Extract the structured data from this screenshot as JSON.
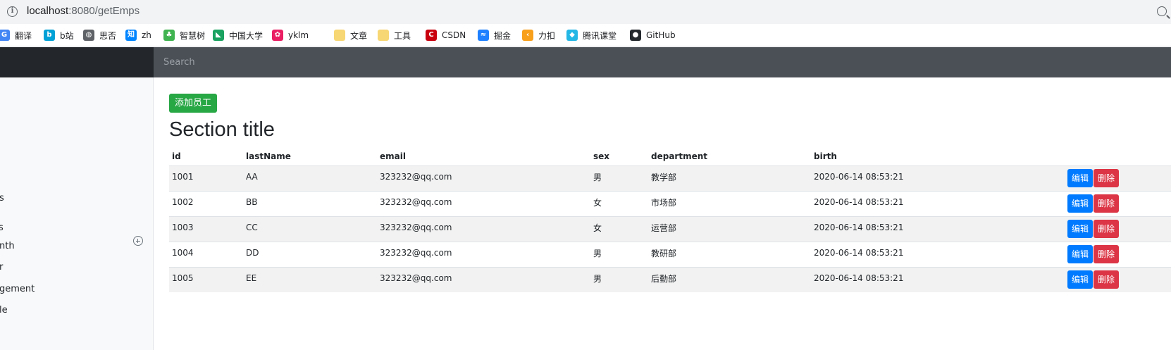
{
  "browser": {
    "url_host": "localhost",
    "url_rest": ":8080/getEmps"
  },
  "bookmarks": [
    {
      "label": "翻译",
      "icon": "google-translate-icon",
      "color": "#4285f4",
      "glyph": "G"
    },
    {
      "label": "b站",
      "icon": "bilibili-icon",
      "color": "#00a1d6",
      "glyph": "b"
    },
    {
      "label": "思否",
      "icon": "globe-icon",
      "color": "#5f6368",
      "glyph": "◍"
    },
    {
      "label": "zh",
      "icon": "zhihu-icon",
      "color": "#0084ff",
      "glyph": "知"
    },
    {
      "label": "智慧树",
      "icon": "zhihuishu-icon",
      "color": "#3fb34f",
      "glyph": "♣"
    },
    {
      "label": "中国大学",
      "icon": "mooc-icon",
      "color": "#1aa260",
      "glyph": "◣"
    },
    {
      "label": "yklm",
      "icon": "yklm-icon",
      "color": "#e91e63",
      "glyph": "✿"
    },
    {
      "label": "文章",
      "icon": "folder-icon",
      "color": "#f7d774",
      "glyph": ""
    },
    {
      "label": "工具",
      "icon": "folder-icon",
      "color": "#f7d774",
      "glyph": ""
    },
    {
      "label": "CSDN",
      "icon": "csdn-icon",
      "color": "#c9000e",
      "glyph": "C"
    },
    {
      "label": "掘金",
      "icon": "juejin-icon",
      "color": "#1e80ff",
      "glyph": "≈"
    },
    {
      "label": "力扣",
      "icon": "leetcode-icon",
      "color": "#f89f1b",
      "glyph": "‹"
    },
    {
      "label": "腾讯课堂",
      "icon": "tencent-class-icon",
      "color": "#23b7e5",
      "glyph": "◆"
    },
    {
      "label": "GitHub",
      "icon": "github-icon",
      "color": "#24292e",
      "glyph": "●"
    }
  ],
  "navbar": {
    "search_placeholder": "Search"
  },
  "sidebar": {
    "items": [
      "s",
      "s",
      "nth",
      "r",
      "gement",
      "le"
    ]
  },
  "main": {
    "add_button": "添加员工",
    "section_title": "Section title",
    "columns": [
      "id",
      "lastName",
      "email",
      "sex",
      "department",
      "birth"
    ],
    "edit_label": "编辑",
    "delete_label": "删除",
    "rows": [
      {
        "id": "1001",
        "lastName": "AA",
        "email": "323232@qq.com",
        "sex": "男",
        "department": "教学部",
        "birth": "2020-06-14 08:53:21"
      },
      {
        "id": "1002",
        "lastName": "BB",
        "email": "323232@qq.com",
        "sex": "女",
        "department": "市场部",
        "birth": "2020-06-14 08:53:21"
      },
      {
        "id": "1003",
        "lastName": "CC",
        "email": "323232@qq.com",
        "sex": "女",
        "department": "运营部",
        "birth": "2020-06-14 08:53:21"
      },
      {
        "id": "1004",
        "lastName": "DD",
        "email": "323232@qq.com",
        "sex": "男",
        "department": "教研部",
        "birth": "2020-06-14 08:53:21"
      },
      {
        "id": "1005",
        "lastName": "EE",
        "email": "323232@qq.com",
        "sex": "男",
        "department": "后勤部",
        "birth": "2020-06-14 08:53:21"
      }
    ]
  }
}
